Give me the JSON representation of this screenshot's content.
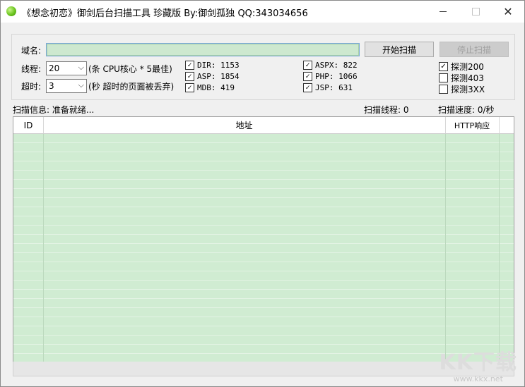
{
  "window": {
    "title": "《想念初恋》御剑后台扫描工具 珍藏版 By:御剑孤独 QQ:343034656",
    "minimize_glyph": "—",
    "maximize_glyph": "☐",
    "close_glyph": "✕"
  },
  "form": {
    "domain_label": "域名:",
    "domain_value": "",
    "start_button": "开始扫描",
    "stop_button": "停止扫描",
    "threads_label": "线程:",
    "threads_value": "20",
    "threads_hint": "(条 CPU核心 * 5最佳)",
    "timeout_label": "超时:",
    "timeout_value": "3",
    "timeout_hint": "(秒 超时的页面被丢弃)"
  },
  "dictionaries": [
    {
      "label": "DIR: 1153",
      "checked": true
    },
    {
      "label": "ASP: 1854",
      "checked": true
    },
    {
      "label": "MDB: 419",
      "checked": true
    },
    {
      "label": "ASPX: 822",
      "checked": true
    },
    {
      "label": "PHP: 1066",
      "checked": true
    },
    {
      "label": "JSP: 631",
      "checked": true
    }
  ],
  "probes": [
    {
      "label": "探测200",
      "checked": true
    },
    {
      "label": "探测403",
      "checked": false
    },
    {
      "label": "探测3XX",
      "checked": false
    }
  ],
  "status": {
    "info": "扫描信息: 准备就绪...",
    "threads": "扫描线程: 0",
    "speed": "扫描速度: 0/秒"
  },
  "table": {
    "columns": [
      "ID",
      "地址",
      "HTTP响应"
    ],
    "rows": []
  },
  "watermark": {
    "logo": "KK下载",
    "url": "www.kkx.net"
  },
  "colors": {
    "grid_background": "#cfe9d1",
    "domain_input": "#cde8cf",
    "app_icon": "#6cc51f"
  }
}
